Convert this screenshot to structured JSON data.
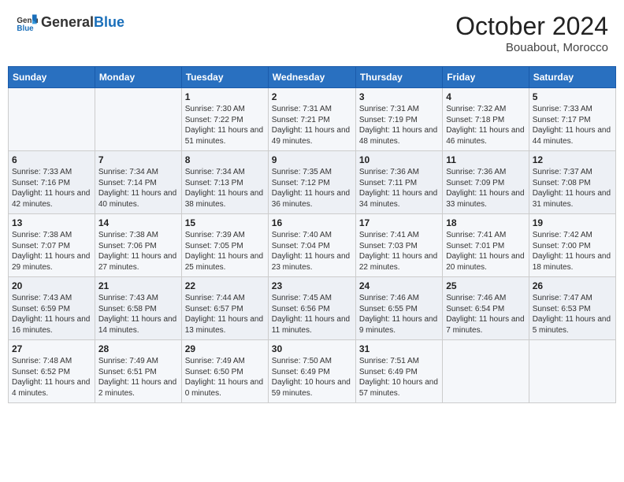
{
  "header": {
    "logo_text_general": "General",
    "logo_text_blue": "Blue",
    "month": "October 2024",
    "location": "Bouabout, Morocco"
  },
  "days_of_week": [
    "Sunday",
    "Monday",
    "Tuesday",
    "Wednesday",
    "Thursday",
    "Friday",
    "Saturday"
  ],
  "weeks": [
    [
      {
        "day": "",
        "info": ""
      },
      {
        "day": "",
        "info": ""
      },
      {
        "day": "1",
        "info": "Sunrise: 7:30 AM\nSunset: 7:22 PM\nDaylight: 11 hours and 51 minutes."
      },
      {
        "day": "2",
        "info": "Sunrise: 7:31 AM\nSunset: 7:21 PM\nDaylight: 11 hours and 49 minutes."
      },
      {
        "day": "3",
        "info": "Sunrise: 7:31 AM\nSunset: 7:19 PM\nDaylight: 11 hours and 48 minutes."
      },
      {
        "day": "4",
        "info": "Sunrise: 7:32 AM\nSunset: 7:18 PM\nDaylight: 11 hours and 46 minutes."
      },
      {
        "day": "5",
        "info": "Sunrise: 7:33 AM\nSunset: 7:17 PM\nDaylight: 11 hours and 44 minutes."
      }
    ],
    [
      {
        "day": "6",
        "info": "Sunrise: 7:33 AM\nSunset: 7:16 PM\nDaylight: 11 hours and 42 minutes."
      },
      {
        "day": "7",
        "info": "Sunrise: 7:34 AM\nSunset: 7:14 PM\nDaylight: 11 hours and 40 minutes."
      },
      {
        "day": "8",
        "info": "Sunrise: 7:34 AM\nSunset: 7:13 PM\nDaylight: 11 hours and 38 minutes."
      },
      {
        "day": "9",
        "info": "Sunrise: 7:35 AM\nSunset: 7:12 PM\nDaylight: 11 hours and 36 minutes."
      },
      {
        "day": "10",
        "info": "Sunrise: 7:36 AM\nSunset: 7:11 PM\nDaylight: 11 hours and 34 minutes."
      },
      {
        "day": "11",
        "info": "Sunrise: 7:36 AM\nSunset: 7:09 PM\nDaylight: 11 hours and 33 minutes."
      },
      {
        "day": "12",
        "info": "Sunrise: 7:37 AM\nSunset: 7:08 PM\nDaylight: 11 hours and 31 minutes."
      }
    ],
    [
      {
        "day": "13",
        "info": "Sunrise: 7:38 AM\nSunset: 7:07 PM\nDaylight: 11 hours and 29 minutes."
      },
      {
        "day": "14",
        "info": "Sunrise: 7:38 AM\nSunset: 7:06 PM\nDaylight: 11 hours and 27 minutes."
      },
      {
        "day": "15",
        "info": "Sunrise: 7:39 AM\nSunset: 7:05 PM\nDaylight: 11 hours and 25 minutes."
      },
      {
        "day": "16",
        "info": "Sunrise: 7:40 AM\nSunset: 7:04 PM\nDaylight: 11 hours and 23 minutes."
      },
      {
        "day": "17",
        "info": "Sunrise: 7:41 AM\nSunset: 7:03 PM\nDaylight: 11 hours and 22 minutes."
      },
      {
        "day": "18",
        "info": "Sunrise: 7:41 AM\nSunset: 7:01 PM\nDaylight: 11 hours and 20 minutes."
      },
      {
        "day": "19",
        "info": "Sunrise: 7:42 AM\nSunset: 7:00 PM\nDaylight: 11 hours and 18 minutes."
      }
    ],
    [
      {
        "day": "20",
        "info": "Sunrise: 7:43 AM\nSunset: 6:59 PM\nDaylight: 11 hours and 16 minutes."
      },
      {
        "day": "21",
        "info": "Sunrise: 7:43 AM\nSunset: 6:58 PM\nDaylight: 11 hours and 14 minutes."
      },
      {
        "day": "22",
        "info": "Sunrise: 7:44 AM\nSunset: 6:57 PM\nDaylight: 11 hours and 13 minutes."
      },
      {
        "day": "23",
        "info": "Sunrise: 7:45 AM\nSunset: 6:56 PM\nDaylight: 11 hours and 11 minutes."
      },
      {
        "day": "24",
        "info": "Sunrise: 7:46 AM\nSunset: 6:55 PM\nDaylight: 11 hours and 9 minutes."
      },
      {
        "day": "25",
        "info": "Sunrise: 7:46 AM\nSunset: 6:54 PM\nDaylight: 11 hours and 7 minutes."
      },
      {
        "day": "26",
        "info": "Sunrise: 7:47 AM\nSunset: 6:53 PM\nDaylight: 11 hours and 5 minutes."
      }
    ],
    [
      {
        "day": "27",
        "info": "Sunrise: 7:48 AM\nSunset: 6:52 PM\nDaylight: 11 hours and 4 minutes."
      },
      {
        "day": "28",
        "info": "Sunrise: 7:49 AM\nSunset: 6:51 PM\nDaylight: 11 hours and 2 minutes."
      },
      {
        "day": "29",
        "info": "Sunrise: 7:49 AM\nSunset: 6:50 PM\nDaylight: 11 hours and 0 minutes."
      },
      {
        "day": "30",
        "info": "Sunrise: 7:50 AM\nSunset: 6:49 PM\nDaylight: 10 hours and 59 minutes."
      },
      {
        "day": "31",
        "info": "Sunrise: 7:51 AM\nSunset: 6:49 PM\nDaylight: 10 hours and 57 minutes."
      },
      {
        "day": "",
        "info": ""
      },
      {
        "day": "",
        "info": ""
      }
    ]
  ]
}
